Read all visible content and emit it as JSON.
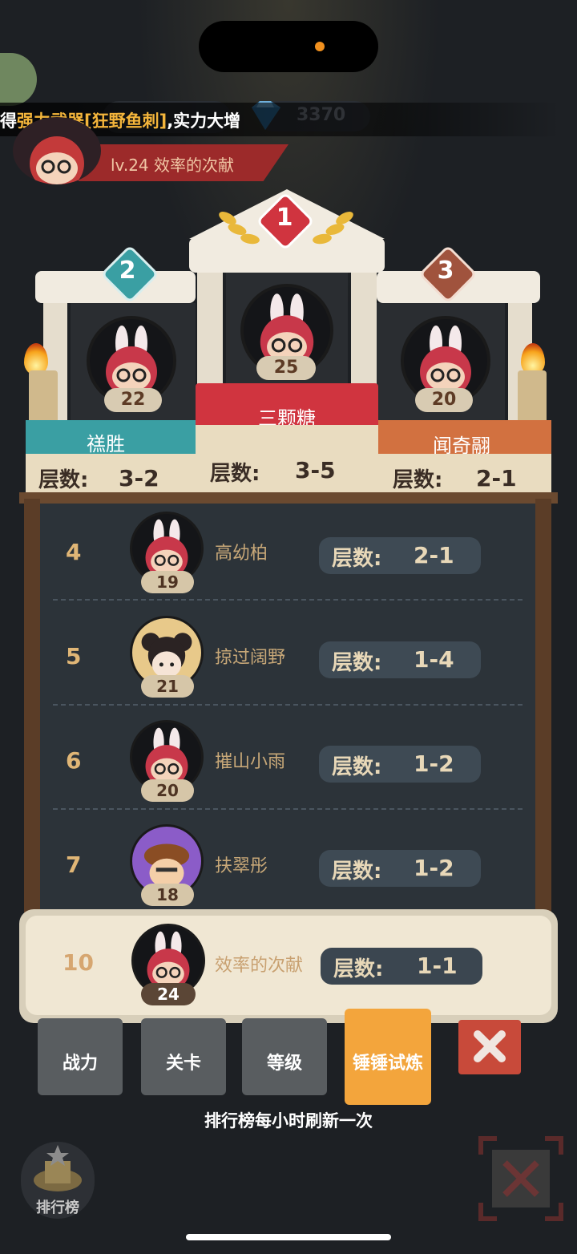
{
  "top": {
    "notice_prefix": "得",
    "notice_highlight": "强力武器[狂野鱼刺]",
    "notice_suffix": ",实力大增",
    "gems": "3370",
    "player_level_name": "lv.24  效率的次献"
  },
  "podium": [
    {
      "rank": "1",
      "level": "25",
      "name": "三颗糖",
      "floor_label": "层数:",
      "floor": "3-5"
    },
    {
      "rank": "2",
      "level": "22",
      "name": "禚胜",
      "floor_label": "层数:",
      "floor": "3-2"
    },
    {
      "rank": "3",
      "level": "20",
      "name": "闻奇翮",
      "floor_label": "层数:",
      "floor": "2-1"
    }
  ],
  "list": [
    {
      "rank": "4",
      "level": "19",
      "name": "高幼柏",
      "floor_label": "层数:",
      "floor": "2-1"
    },
    {
      "rank": "5",
      "level": "21",
      "name": "掠过阔野",
      "floor_label": "层数:",
      "floor": "1-4"
    },
    {
      "rank": "6",
      "level": "20",
      "name": "摧山小雨",
      "floor_label": "层数:",
      "floor": "1-2"
    },
    {
      "rank": "7",
      "level": "18",
      "name": "扶翠彤",
      "floor_label": "层数:",
      "floor": "1-2"
    }
  ],
  "me": {
    "rank": "10",
    "level": "24",
    "name": "效率的次献",
    "floor_label": "层数:",
    "floor": "1-1"
  },
  "tabs": [
    {
      "label": "战力"
    },
    {
      "label": "关卡"
    },
    {
      "label": "等级"
    },
    {
      "label": "锤锤试炼"
    }
  ],
  "refresh_note": "排行榜每小时刷新一次",
  "bottom": {
    "rank_button": "排行榜"
  },
  "colors": {
    "background": "#1d2024",
    "rank1": "#d0343f",
    "rank2": "#3a9fa3",
    "rank3": "#a0533d",
    "accent_orange": "#f3a53c",
    "text_gold": "#e0b676"
  }
}
